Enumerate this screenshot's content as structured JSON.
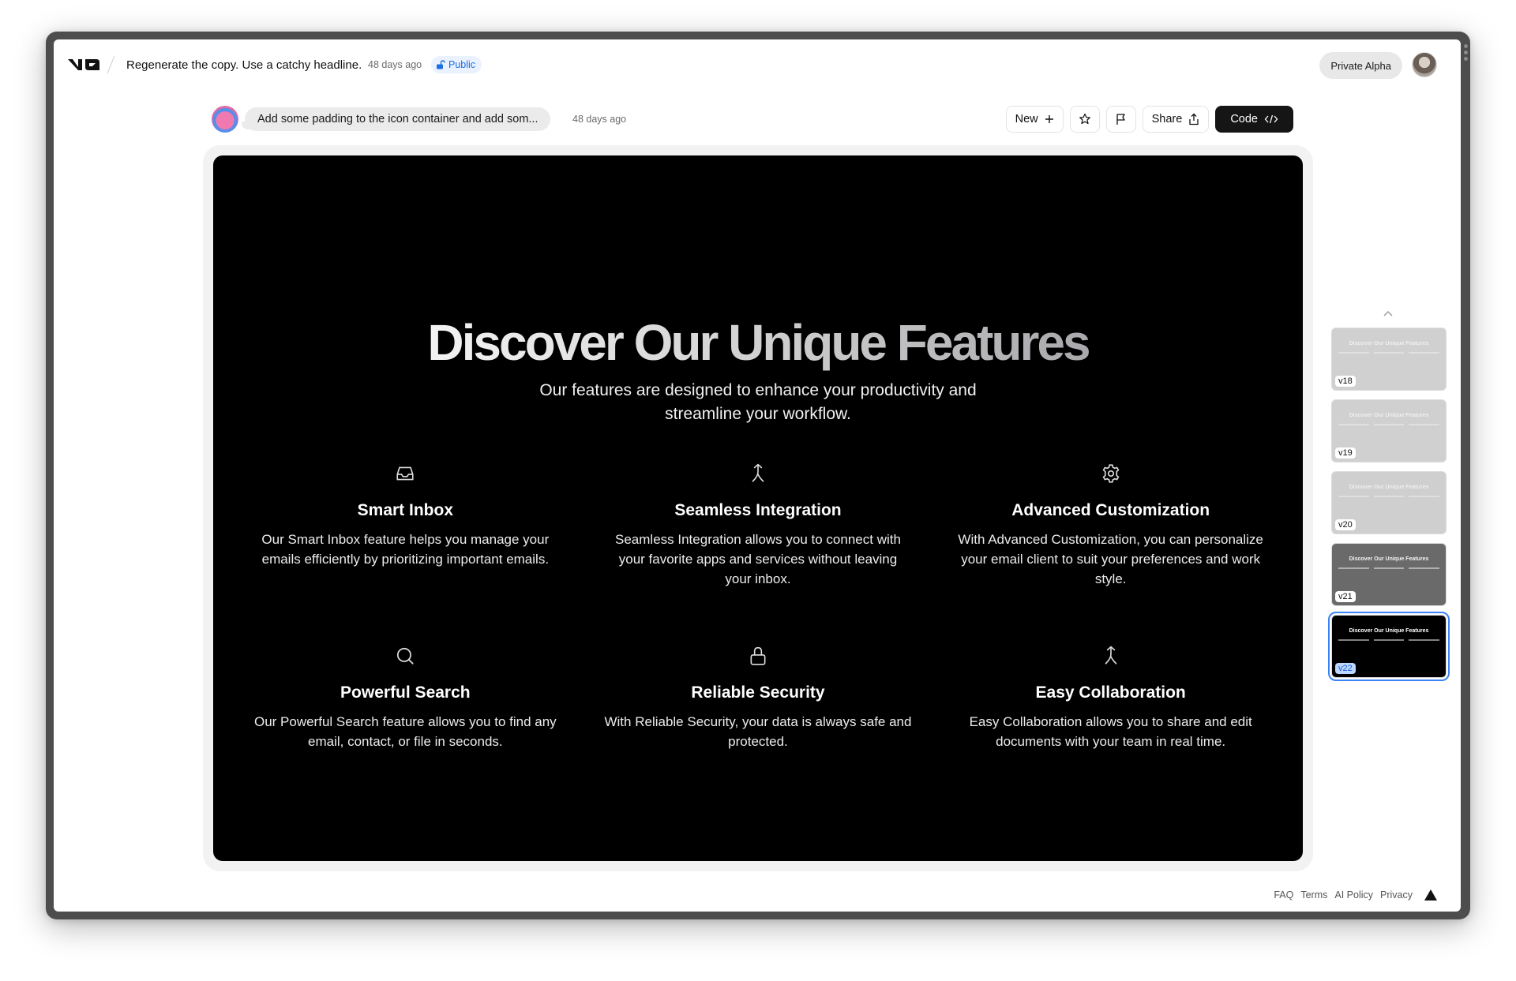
{
  "header": {
    "logo": "v0-logo",
    "title": "Regenerate the copy. Use a catchy headline.",
    "time": "48 days ago",
    "visibility": "Public",
    "plan_badge": "Private Alpha"
  },
  "prompt": {
    "text": "Add some padding to the icon container and add som...",
    "time": "48 days ago"
  },
  "toolbar": {
    "new_label": "New",
    "share_label": "Share",
    "code_label": "Code"
  },
  "preview": {
    "headline": "Discover Our Unique Features",
    "subhead_line1": "Our features are designed to enhance your productivity and",
    "subhead_line2": "streamline your workflow.",
    "features": [
      {
        "icon": "inbox-icon",
        "title": "Smart Inbox",
        "description": "Our Smart Inbox feature helps you manage your emails efficiently by prioritizing important emails."
      },
      {
        "icon": "merge-icon",
        "title": "Seamless Integration",
        "description": "Seamless Integration allows you to connect with your favorite apps and services without leaving your inbox."
      },
      {
        "icon": "gear-icon",
        "title": "Advanced Customization",
        "description": "With Advanced Customization, you can personalize your email client to suit your preferences and work style."
      },
      {
        "icon": "search-icon",
        "title": "Powerful Search",
        "description": "Our Powerful Search feature allows you to find any email, contact, or file in seconds."
      },
      {
        "icon": "lock-icon",
        "title": "Reliable Security",
        "description": "With Reliable Security, your data is always safe and protected."
      },
      {
        "icon": "merge-icon",
        "title": "Easy Collaboration",
        "description": "Easy Collaboration allows you to share and edit documents with your team in real time."
      }
    ]
  },
  "versions": [
    {
      "label": "v18",
      "bg": "#d0d0d0",
      "fg": "#efefef",
      "active": false
    },
    {
      "label": "v19",
      "bg": "#d0d0d0",
      "fg": "#efefef",
      "active": false
    },
    {
      "label": "v20",
      "bg": "#cfcfcf",
      "fg": "#efefef",
      "active": false
    },
    {
      "label": "v21",
      "bg": "#6a6a6a",
      "fg": "#f3f3f3",
      "active": false
    },
    {
      "label": "v22",
      "bg": "#000000",
      "fg": "#ffffff",
      "active": true
    }
  ],
  "versions_thumb_title": "Discover Our Unique Features",
  "footer": {
    "links": [
      "FAQ",
      "Terms",
      "AI Policy",
      "Privacy"
    ]
  },
  "colors": {
    "accent": "#3b82f6",
    "public_badge": "#1a6fe3"
  }
}
